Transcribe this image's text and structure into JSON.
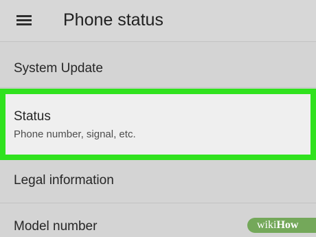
{
  "app_bar": {
    "menu_icon": "hamburger-menu-icon",
    "title": "Phone status"
  },
  "rows": [
    {
      "title": "System Update"
    },
    {
      "title": "Status",
      "subtitle": "Phone number, signal, etc.",
      "highlight_color": "#30e21e"
    },
    {
      "title": "Legal information"
    },
    {
      "title": "Model number"
    }
  ],
  "watermark": {
    "part1": "wiki",
    "part2": "How"
  }
}
